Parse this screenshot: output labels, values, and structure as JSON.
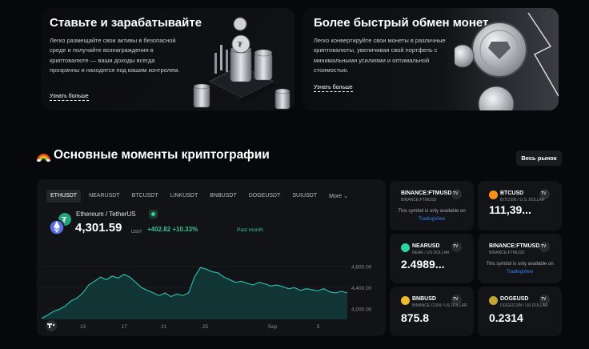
{
  "cards": [
    {
      "title": "Ставьте и зарабатывайте",
      "body": "Легко размещайте свои активы в безопасной среде и получайте вознаграждения в криптовалюте — ваши доходы всегда прозрачны и находятся под вашим контролем.",
      "link": "Узнать больше"
    },
    {
      "title": "Более быстрый обмен монет",
      "body": "Легко конвертируйте свои монеты в различные криптовалюты, увеличивая свой портфель с минимальными усилиями и оптимальной стоимостью.",
      "link": "Узнать больше"
    }
  ],
  "section": {
    "title": "Основные моменты криптографии",
    "all_market": "Весь рынок"
  },
  "chart_panel": {
    "tabs": [
      "ETHUSDT",
      "NEARUSDT",
      "BTCUSDT",
      "LINKUSDT",
      "BNBUSDT",
      "DOGEUSDT",
      "SUIUSDT",
      "More"
    ],
    "pair": "Ethereum / TetherUS",
    "price": "4,301.59",
    "currency": "USDT",
    "change": "+402.82",
    "change_pct": "+10.33%",
    "period": "Past month"
  },
  "chart_data": {
    "type": "area",
    "x_ticks": [
      "13",
      "17",
      "21",
      "25",
      "Sep",
      "5"
    ],
    "y_ticks": [
      "4,800.00",
      "4,400.00",
      "4,000.00"
    ],
    "ylim": [
      3800,
      4950
    ],
    "values": [
      3820,
      3880,
      3950,
      3990,
      4050,
      4150,
      4200,
      4300,
      4450,
      4520,
      4600,
      4550,
      4620,
      4580,
      4650,
      4600,
      4500,
      4400,
      4350,
      4300,
      4250,
      4300,
      4230,
      4280,
      4250,
      4300,
      4600,
      4780,
      4750,
      4700,
      4680,
      4600,
      4550,
      4500,
      4520,
      4480,
      4450,
      4500,
      4470,
      4430,
      4450,
      4420,
      4380,
      4400,
      4350,
      4380,
      4360,
      4340,
      4380,
      4320,
      4300,
      4330,
      4300
    ],
    "colors": {
      "line": "#2fb7a8",
      "fill": "#123c3a"
    }
  },
  "tickers": [
    {
      "symbol": "BINANCE:FTMUSD",
      "sub": "BINANCE:FTMUSD",
      "note": "This symbol is only available on",
      "note_link": "TradingView"
    },
    {
      "symbol": "BTCUSD",
      "sub": "BITCOIN / U.S. DOLLAR",
      "value": "111,39...",
      "coin_color": "#f7931a"
    },
    {
      "symbol": "NEARUSD",
      "sub": "NEAR / US DOLLAR",
      "value": "2.4989...",
      "coin_color": "#2fd49a"
    },
    {
      "symbol": "BINANCE:FTMUSD",
      "sub": "BINANCE:FTMUSD",
      "note": "This symbol is only available on",
      "note_link": "TradingView"
    },
    {
      "symbol": "BNBUSD",
      "sub": "BINANCE COIN / US DOLLAR",
      "value": "875.8",
      "coin_color": "#f3ba2f"
    },
    {
      "symbol": "DOGEUSD",
      "sub": "DOGECOIN / US DOLLAR",
      "value": "0.2314",
      "coin_color": "#c2a633"
    }
  ]
}
